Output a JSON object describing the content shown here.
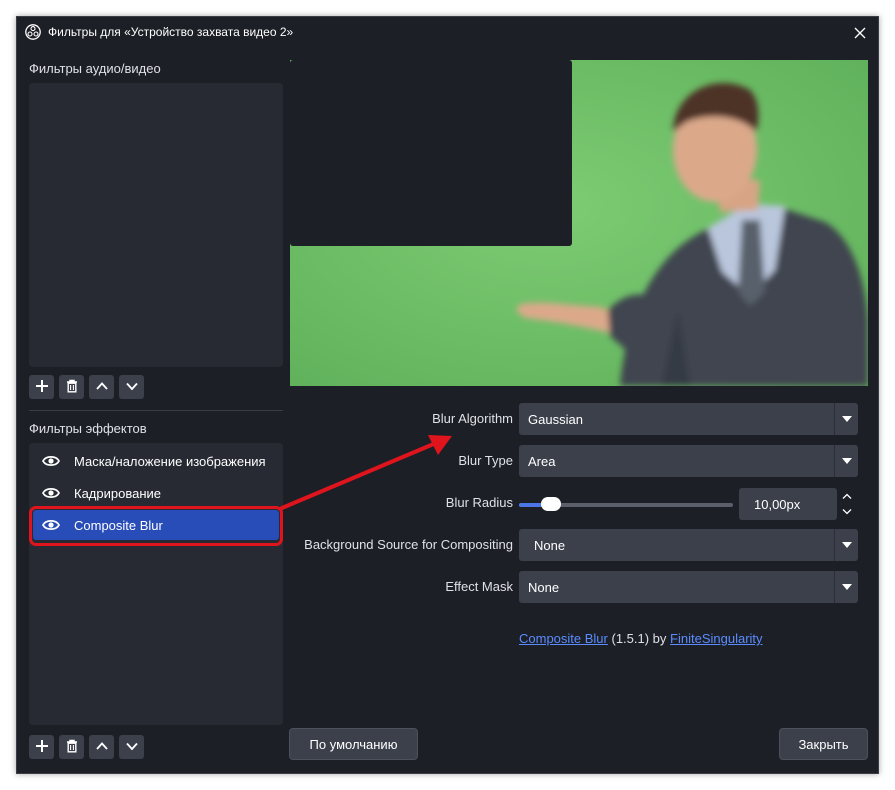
{
  "window": {
    "title": "Фильтры для «Устройство захвата видео 2»",
    "app_icon": "obs-logo-icon",
    "close_icon": "close-icon"
  },
  "audio_video_filters": {
    "label": "Фильтры аудио/видео",
    "items": []
  },
  "effect_filters": {
    "label": "Фильтры эффектов",
    "items": [
      {
        "label": "Маска/наложение изображения",
        "icon": "eye-icon",
        "selected": false
      },
      {
        "label": "Кадрирование",
        "icon": "eye-icon",
        "selected": false
      },
      {
        "label": "Composite Blur",
        "icon": "eye-icon",
        "selected": true
      }
    ]
  },
  "toolbar": {
    "add_icon": "plus-icon",
    "remove_icon": "trash-icon",
    "up_icon": "chevron-up-icon",
    "down_icon": "chevron-down-icon"
  },
  "properties": {
    "blur_algorithm": {
      "label": "Blur Algorithm",
      "value": "Gaussian"
    },
    "blur_type": {
      "label": "Blur Type",
      "value": "Area"
    },
    "blur_radius": {
      "label": "Blur Radius",
      "value": "10,00px",
      "slider_fraction": 0.15
    },
    "background_source": {
      "label": "Background Source for Compositing",
      "value": "None"
    },
    "effect_mask": {
      "label": "Effect Mask",
      "value": "None"
    }
  },
  "credit": {
    "plugin_link": "Composite Blur",
    "version": "(1.5.1) by",
    "author_link": "FiniteSingularity"
  },
  "buttons": {
    "defaults": "По умолчанию",
    "close": "Закрыть"
  },
  "colors": {
    "window_bg": "#1d1f26",
    "panel_bg": "#272a33",
    "control_bg": "#3c404b",
    "selection": "#284cb8",
    "accent": "#4a76e8",
    "link": "#5a8cff",
    "annotation": "#e0141c",
    "green_screen": "#6cc064"
  }
}
